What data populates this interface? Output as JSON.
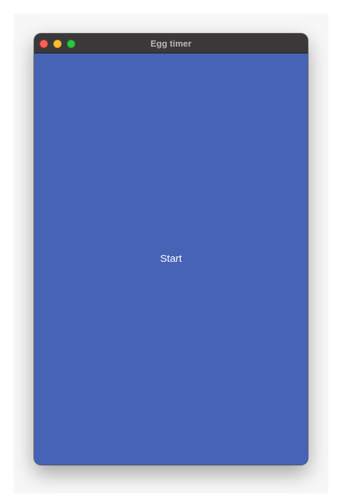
{
  "window": {
    "title": "Egg timer"
  },
  "main": {
    "start_label": "Start"
  },
  "colors": {
    "background": "#4663b6",
    "titlebar": "#3b3839",
    "title_text": "#b9b6b7",
    "button_text": "#ffffff"
  }
}
